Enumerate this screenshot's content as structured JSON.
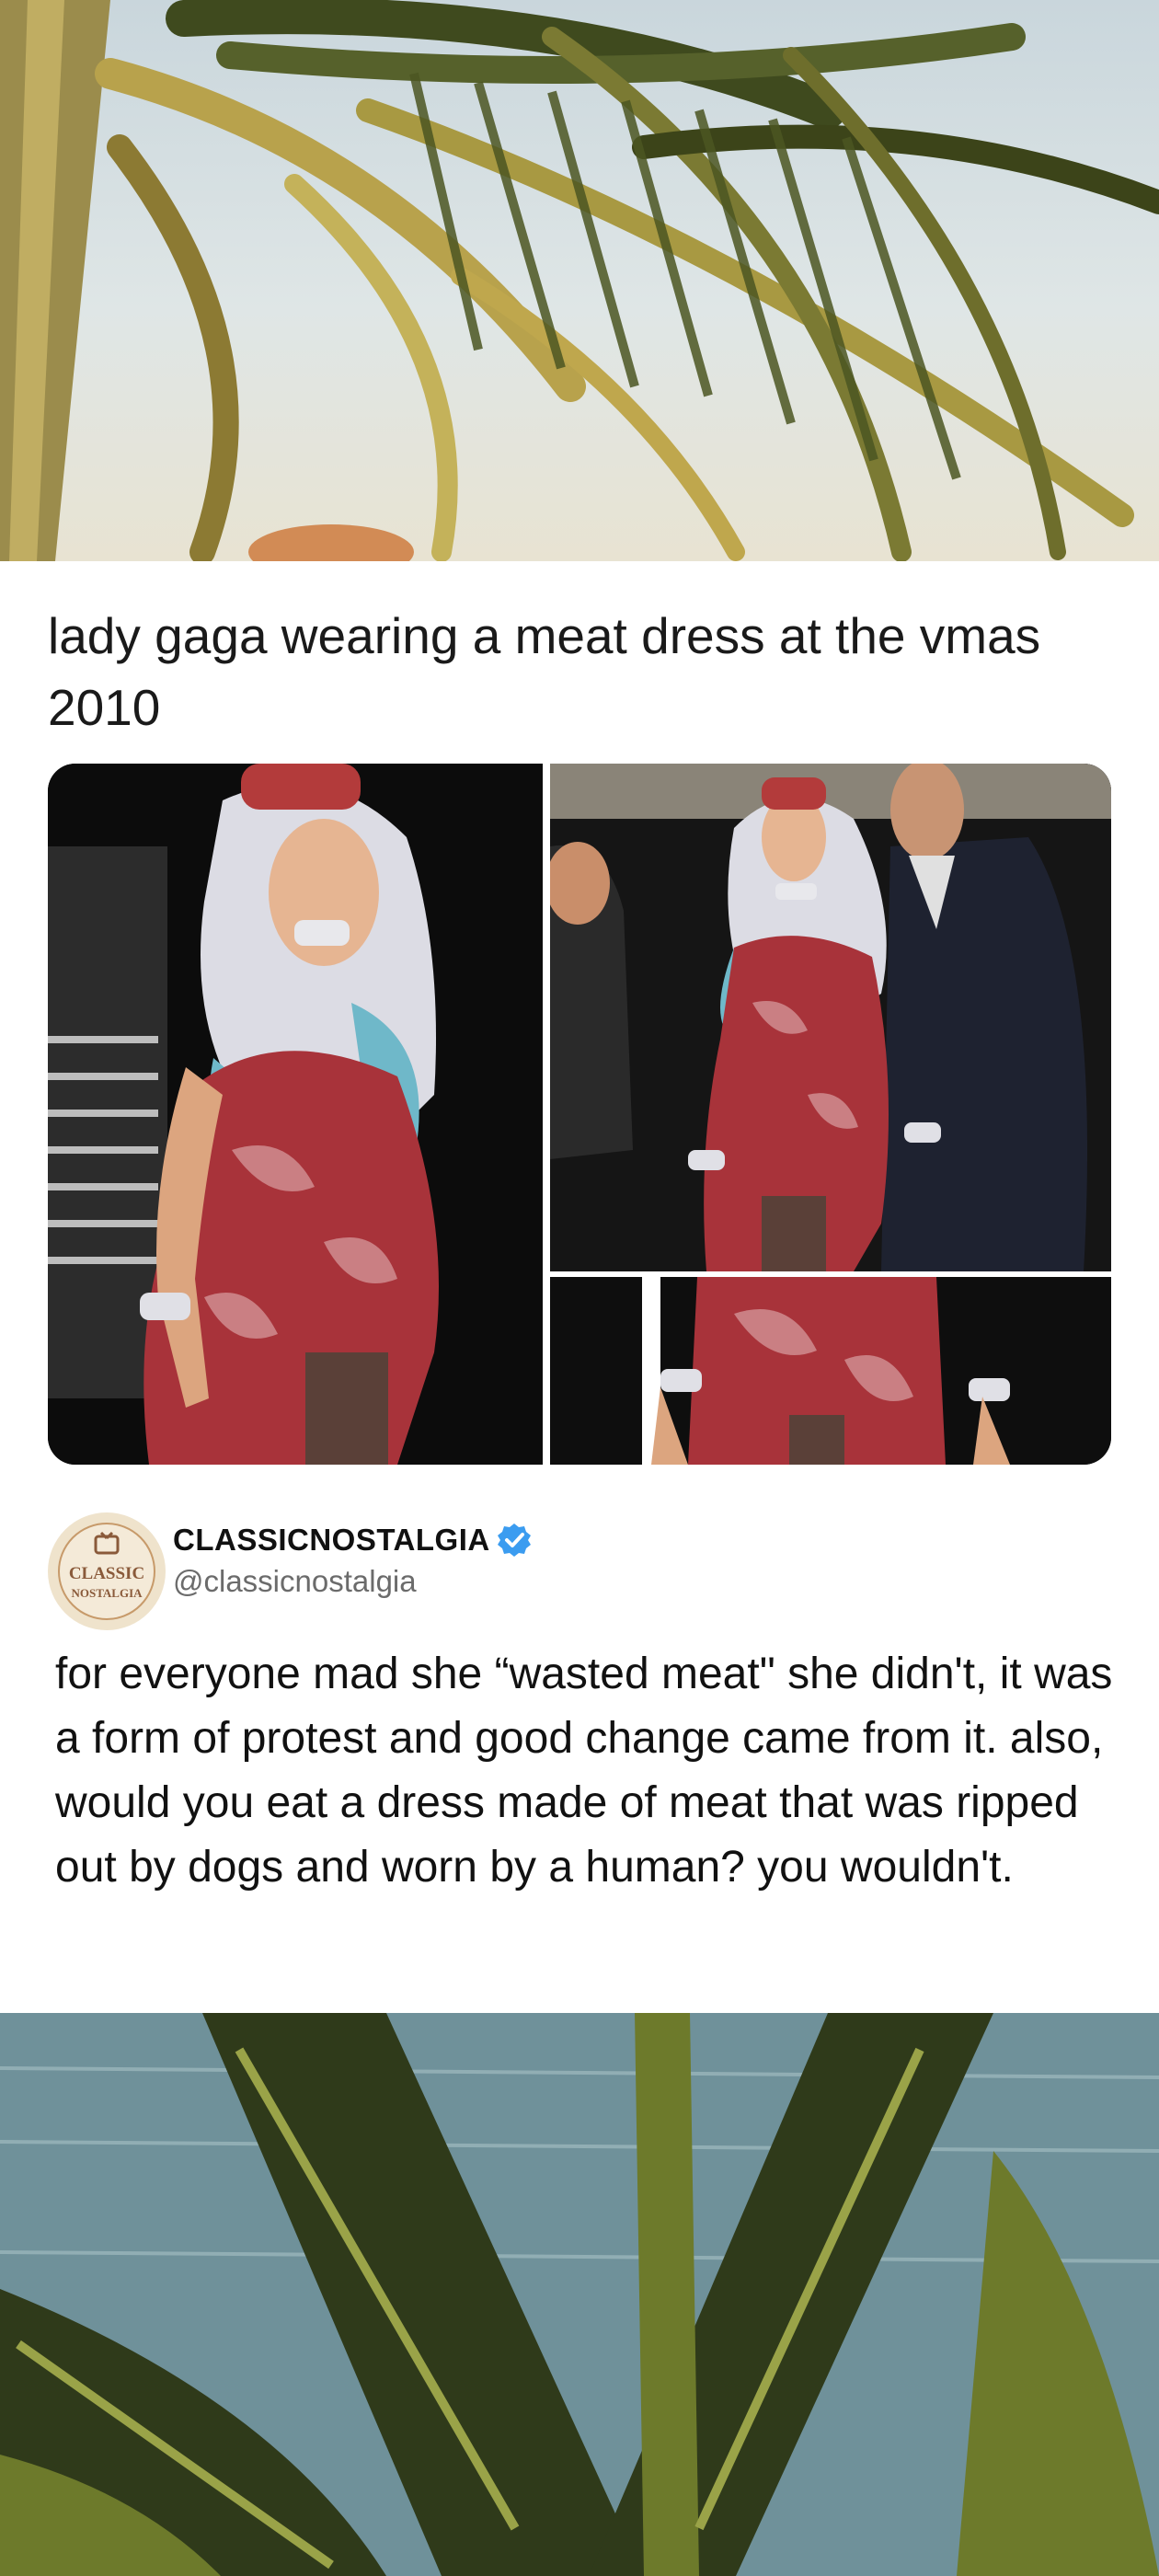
{
  "post": {
    "title": "lady gaga wearing a meat dress at the vmas 2010"
  },
  "source": {
    "display_name": "CLASSICNOSTALGIA",
    "username": "@classicnostalgia",
    "avatar_text_line1": "CLASSIC",
    "avatar_text_line2": "NOSTALGIA",
    "verified": true
  },
  "tweet": {
    "text": "for everyone mad she “wasted meat\" she didn't, it was a form of protest and good change came from it. also, would you eat a dress made of meat that was ripped out by dogs and worn by a human? you wouldn't."
  },
  "colors": {
    "verified_badge": "#3b9cf0",
    "meat": "#a8333a",
    "hair": "#dcdce4",
    "hair_tip": "#6fb8c9"
  }
}
